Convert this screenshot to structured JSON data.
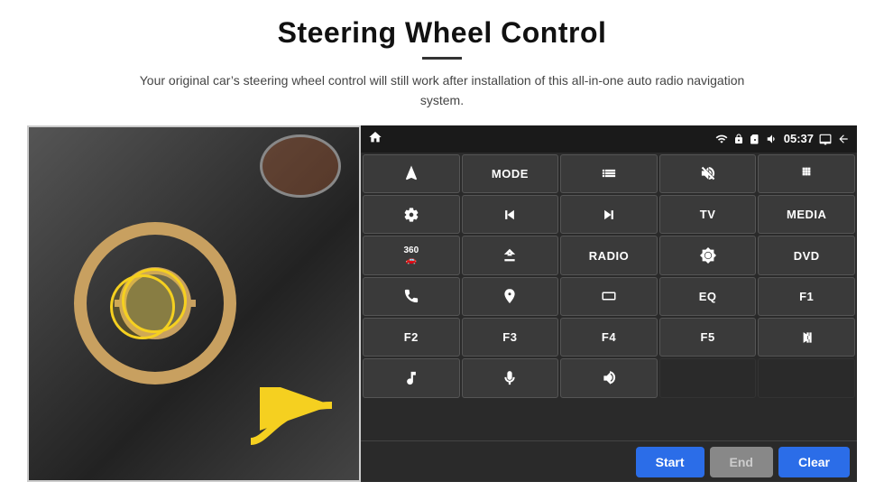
{
  "header": {
    "title": "Steering Wheel Control",
    "subtitle": "Your original car’s steering wheel control will still work after installation of this all-in-one auto radio navigation system."
  },
  "status_bar": {
    "home_icon": "home",
    "wifi_icon": "wifi",
    "lock_icon": "lock",
    "sim_icon": "sim",
    "audio_icon": "audio",
    "time": "05:37",
    "screen_icon": "screen",
    "back_icon": "back"
  },
  "buttons": [
    {
      "id": "nav",
      "type": "icon",
      "icon": "navigate"
    },
    {
      "id": "mode",
      "type": "text",
      "label": "MODE"
    },
    {
      "id": "list",
      "type": "icon",
      "icon": "list"
    },
    {
      "id": "mute",
      "type": "icon",
      "icon": "mute"
    },
    {
      "id": "apps",
      "type": "icon",
      "icon": "apps"
    },
    {
      "id": "settings",
      "type": "icon",
      "icon": "settings"
    },
    {
      "id": "prev",
      "type": "icon",
      "icon": "prev"
    },
    {
      "id": "next",
      "type": "icon",
      "icon": "next"
    },
    {
      "id": "tv",
      "type": "text",
      "label": "TV"
    },
    {
      "id": "media",
      "type": "text",
      "label": "MEDIA"
    },
    {
      "id": "360cam",
      "type": "icon",
      "icon": "360cam"
    },
    {
      "id": "eject",
      "type": "icon",
      "icon": "eject"
    },
    {
      "id": "radio",
      "type": "text",
      "label": "RADIO"
    },
    {
      "id": "brightness",
      "type": "icon",
      "icon": "brightness"
    },
    {
      "id": "dvd",
      "type": "text",
      "label": "DVD"
    },
    {
      "id": "phone",
      "type": "icon",
      "icon": "phone"
    },
    {
      "id": "navi",
      "type": "icon",
      "icon": "navi"
    },
    {
      "id": "screen",
      "type": "icon",
      "icon": "screen-rect"
    },
    {
      "id": "eq",
      "type": "text",
      "label": "EQ"
    },
    {
      "id": "f1",
      "type": "text",
      "label": "F1"
    },
    {
      "id": "f2",
      "type": "text",
      "label": "F2"
    },
    {
      "id": "f3",
      "type": "text",
      "label": "F3"
    },
    {
      "id": "f4",
      "type": "text",
      "label": "F4"
    },
    {
      "id": "f5",
      "type": "text",
      "label": "F5"
    },
    {
      "id": "playpause",
      "type": "icon",
      "icon": "playpause"
    },
    {
      "id": "music",
      "type": "icon",
      "icon": "music"
    },
    {
      "id": "mic",
      "type": "icon",
      "icon": "mic"
    },
    {
      "id": "mute2",
      "type": "icon",
      "icon": "mute2"
    },
    {
      "id": "empty1",
      "type": "empty"
    },
    {
      "id": "empty2",
      "type": "empty"
    }
  ],
  "action_bar": {
    "start_label": "Start",
    "end_label": "End",
    "clear_label": "Clear"
  }
}
